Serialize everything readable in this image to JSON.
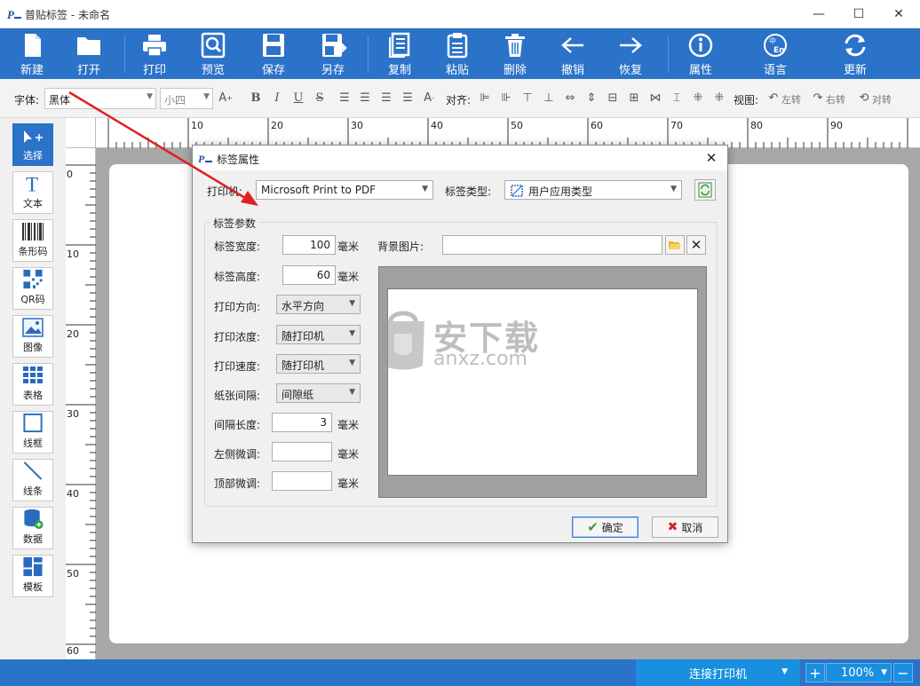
{
  "window": {
    "title": "普贴标签 - 未命名",
    "minimize_glyph": "—",
    "maximize_glyph": "☐",
    "close_glyph": "✕"
  },
  "toolbar": {
    "new": "新建",
    "open": "打开",
    "print": "打印",
    "preview": "预览",
    "save": "保存",
    "save_as": "另存",
    "copy": "复制",
    "paste": "粘贴",
    "delete": "删除",
    "undo": "撤销",
    "redo": "恢复",
    "properties": "属性",
    "language": "语言",
    "update": "更新"
  },
  "format_bar": {
    "font_label": "字体:",
    "font_value": "黑体",
    "size_value": "小四",
    "align_label": "对齐:",
    "view_label": "视图:",
    "rotate_left": "左转",
    "rotate_right": "右转",
    "flip": "对转"
  },
  "palette": {
    "select": "选择",
    "text": "文本",
    "barcode": "条形码",
    "qrcode": "QR码",
    "image": "图像",
    "table": "表格",
    "frame": "线框",
    "line": "线条",
    "data": "数据",
    "template": "模板"
  },
  "rulers": {
    "top": [
      "10",
      "20",
      "30",
      "40",
      "50",
      "60",
      "70",
      "80",
      "90"
    ],
    "left": [
      "0",
      "10",
      "20",
      "30",
      "40",
      "50",
      "60"
    ]
  },
  "statusbar": {
    "connect": "连接打印机",
    "zoom": "100%",
    "zoom_in": "+",
    "zoom_out": "−"
  },
  "dialog": {
    "title": "标签属性",
    "printer_label": "打印机:",
    "printer_value": "Microsoft Print to PDF",
    "label_type_label": "标签类型:",
    "label_type_value": "用户应用类型",
    "group_title": "标签参数",
    "width_label": "标签宽度:",
    "width_value": "100",
    "height_label": "标签高度:",
    "height_value": "60",
    "unit": "毫米",
    "direction_label": "打印方向:",
    "direction_value": "水平方向",
    "density_label": "打印浓度:",
    "density_value": "随打印机",
    "speed_label": "打印速度:",
    "speed_value": "随打印机",
    "gap_label": "纸张间隔:",
    "gap_value": "间隙纸",
    "gap_length_label": "间隔长度:",
    "gap_length_value": "3",
    "left_adjust_label": "左侧微调:",
    "left_adjust_value": "",
    "top_adjust_label": "顶部微调:",
    "top_adjust_value": "",
    "bg_image_label": "背景图片:",
    "bg_image_value": "",
    "ok": "确定",
    "cancel": "取消"
  },
  "watermark": {
    "cn": "安下载",
    "en": "anxz.com"
  },
  "colors": {
    "toolbar_blue": "#2b72c9",
    "status_blue": "#1a8fe0",
    "annotation_red": "#e02020"
  }
}
